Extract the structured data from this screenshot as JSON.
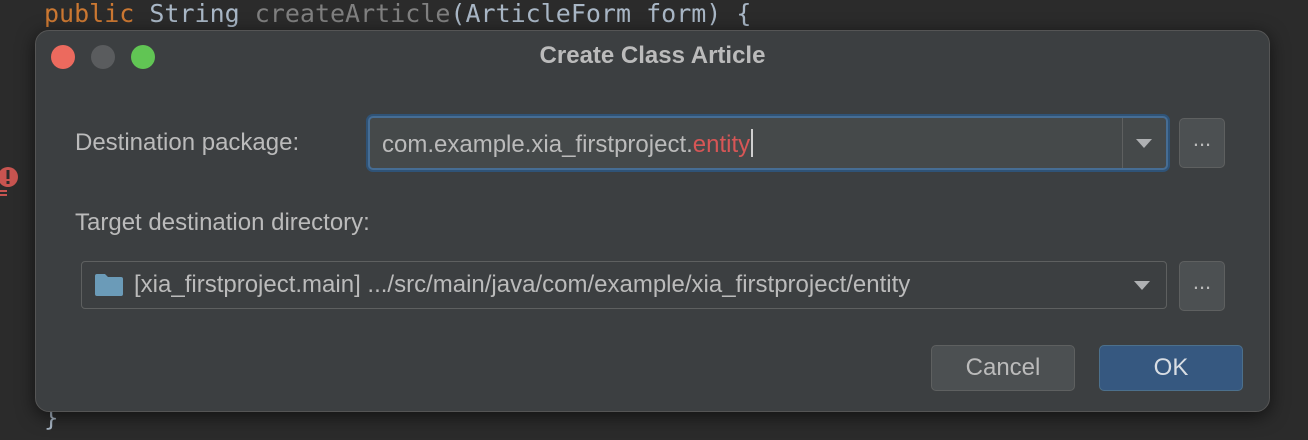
{
  "editor": {
    "keyword": "public",
    "type": "String",
    "method": "createArticle",
    "params": "(ArticleForm form) {",
    "closing_brace": "}"
  },
  "dialog": {
    "title": "Create Class Article",
    "destination_package": {
      "label": "Destination package:",
      "value_prefix": "com.example.xia_firstproject.",
      "value_error": "entity",
      "browse_label": "..."
    },
    "target_directory": {
      "label": "Target destination directory:",
      "value": "[xia_firstproject.main] .../src/main/java/com/example/xia_firstproject/entity",
      "icon": "folder-icon",
      "browse_label": "..."
    },
    "buttons": {
      "cancel": "Cancel",
      "ok": "OK"
    }
  },
  "colors": {
    "close": "#ec6a5e",
    "maximize": "#61c554",
    "error_text": "#d65656",
    "primary_button": "#365880"
  }
}
